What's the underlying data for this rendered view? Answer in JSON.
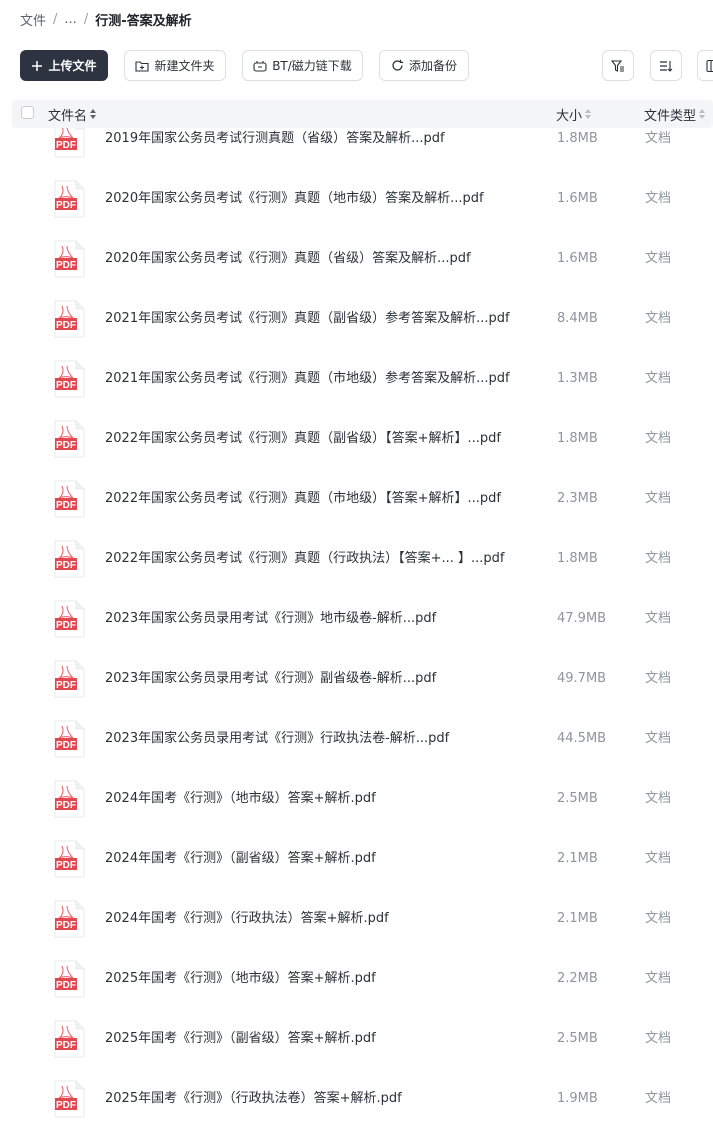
{
  "breadcrumb": {
    "root": "文件",
    "ellipsis": "...",
    "current": "行测-答案及解析",
    "separator": "/"
  },
  "toolbar": {
    "upload_label": "上传文件",
    "new_folder_label": "新建文件夹",
    "bt_label": "BT/磁力链下载",
    "backup_label": "添加备份"
  },
  "table": {
    "col_name": "文件名",
    "col_size": "大小",
    "col_type": "文件类型"
  },
  "icon_label": "PDF",
  "colors": {
    "primary_button": "#2e3342",
    "pdf_red": "#e2474f",
    "muted_text": "#8f959e"
  },
  "files": [
    {
      "name": "2019年国家公务员考试行测真题（省级）答案及解析...pdf",
      "size": "1.8MB",
      "type": "文档"
    },
    {
      "name": "2020年国家公务员考试《行测》真题（地市级）答案及解析...pdf",
      "size": "1.6MB",
      "type": "文档"
    },
    {
      "name": "2020年国家公务员考试《行测》真题（省级）答案及解析...pdf",
      "size": "1.6MB",
      "type": "文档"
    },
    {
      "name": "2021年国家公务员考试《行测》真题（副省级）参考答案及解析...pdf",
      "size": "8.4MB",
      "type": "文档"
    },
    {
      "name": "2021年国家公务员考试《行测》真题（市地级）参考答案及解析...pdf",
      "size": "1.3MB",
      "type": "文档"
    },
    {
      "name": "2022年国家公务员考试《行测》真题（副省级）【答案+解析】...pdf",
      "size": "1.8MB",
      "type": "文档"
    },
    {
      "name": "2022年国家公务员考试《行测》真题（市地级）【答案+解析】...pdf",
      "size": "2.3MB",
      "type": "文档"
    },
    {
      "name": "2022年国家公务员考试《行测》真题（行政执法）【答案+... 】...pdf",
      "size": "1.8MB",
      "type": "文档"
    },
    {
      "name": "2023年国家公务员录用考试《行测》地市级卷-解析...pdf",
      "size": "47.9MB",
      "type": "文档"
    },
    {
      "name": "2023年国家公务员录用考试《行测》副省级卷-解析...pdf",
      "size": "49.7MB",
      "type": "文档"
    },
    {
      "name": "2023年国家公务员录用考试《行测》行政执法卷-解析...pdf",
      "size": "44.5MB",
      "type": "文档"
    },
    {
      "name": "2024年国考《行测》（地市级）答案+解析.pdf",
      "size": "2.5MB",
      "type": "文档"
    },
    {
      "name": "2024年国考《行测》（副省级）答案+解析.pdf",
      "size": "2.1MB",
      "type": "文档"
    },
    {
      "name": "2024年国考《行测》（行政执法）答案+解析.pdf",
      "size": "2.1MB",
      "type": "文档"
    },
    {
      "name": "2025年国考《行测》（地市级）答案+解析.pdf",
      "size": "2.2MB",
      "type": "文档"
    },
    {
      "name": "2025年国考《行测》（副省级）答案+解析.pdf",
      "size": "2.5MB",
      "type": "文档"
    },
    {
      "name": "2025年国考《行测》（行政执法卷）答案+解析.pdf",
      "size": "1.9MB",
      "type": "文档"
    }
  ]
}
